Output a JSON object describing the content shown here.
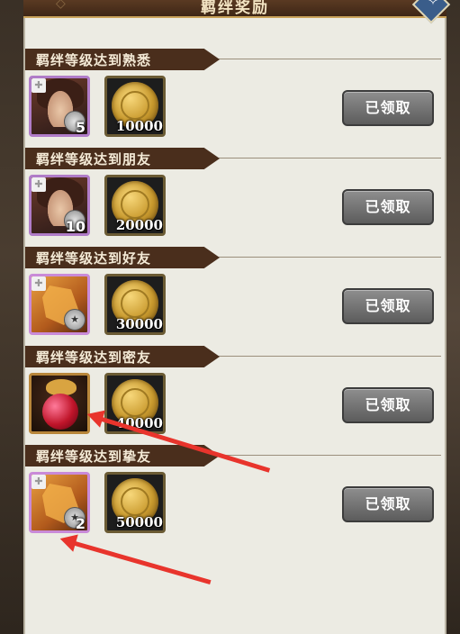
{
  "header": {
    "title": "羁绊奖励",
    "close_icon": "star-close-icon"
  },
  "colors": {
    "header_bg": "#4a2e1c",
    "panel_bg": "#ecebe3",
    "button_bg": "#6e6e6e",
    "arrow": "#e8342c"
  },
  "rows": [
    {
      "title": "羁绊等级达到熟悉",
      "item1": {
        "type": "hero-fragment",
        "count": "5"
      },
      "item2": {
        "type": "gold-coin",
        "amount": "10000"
      },
      "button": "已领取"
    },
    {
      "title": "羁绊等级达到朋友",
      "item1": {
        "type": "hero-fragment",
        "count": "10"
      },
      "item2": {
        "type": "gold-coin",
        "amount": "20000"
      },
      "button": "已领取"
    },
    {
      "title": "羁绊等级达到好友",
      "item1": {
        "type": "skin-fragment"
      },
      "item2": {
        "type": "gold-coin",
        "amount": "30000"
      },
      "button": "已领取"
    },
    {
      "title": "羁绊等级达到密友",
      "item1": {
        "type": "potion"
      },
      "item2": {
        "type": "gold-coin",
        "amount": "40000"
      },
      "button": "已领取"
    },
    {
      "title": "羁绊等级达到挚友",
      "item1": {
        "type": "skin-fragment",
        "count": "2"
      },
      "item2": {
        "type": "gold-coin",
        "amount": "50000"
      },
      "button": "已领取"
    }
  ]
}
